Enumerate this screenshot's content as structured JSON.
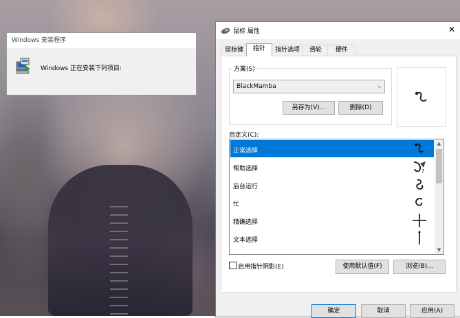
{
  "installer": {
    "title": "Windows 安装程序",
    "message": "Windows 正在安装下列项目:"
  },
  "dialog": {
    "title": "鼠标 属性",
    "close_glyph": "✕",
    "tabs": [
      {
        "label": "鼠标键"
      },
      {
        "label": "指针"
      },
      {
        "label": "指针选项"
      },
      {
        "label": "滑轮"
      },
      {
        "label": "硬件"
      }
    ],
    "scheme": {
      "group_label": "方案(S)",
      "selected": "BlackMamba",
      "save_as": "另存为(V)...",
      "delete": "删除(D)"
    },
    "customize_label": "自定义(C):",
    "cursors": [
      {
        "label": "正常选择",
        "icon": "arrow-cursor"
      },
      {
        "label": "帮助选择",
        "icon": "help-cursor"
      },
      {
        "label": "后台运行",
        "icon": "working-cursor"
      },
      {
        "label": "忙",
        "icon": "busy-cursor"
      },
      {
        "label": "精确选择",
        "icon": "crosshair-cursor"
      },
      {
        "label": "文本选择",
        "icon": "text-cursor"
      }
    ],
    "shadow_label": "启用指针阴影(E)",
    "shadow_checked": false,
    "use_default": "使用默认值(F)",
    "browse": "浏览(B)...",
    "ok": "确定",
    "cancel": "取消",
    "apply": "应用(A)"
  },
  "colors": {
    "accent": "#0078d7",
    "dialog_bg": "#f0f0f0"
  }
}
